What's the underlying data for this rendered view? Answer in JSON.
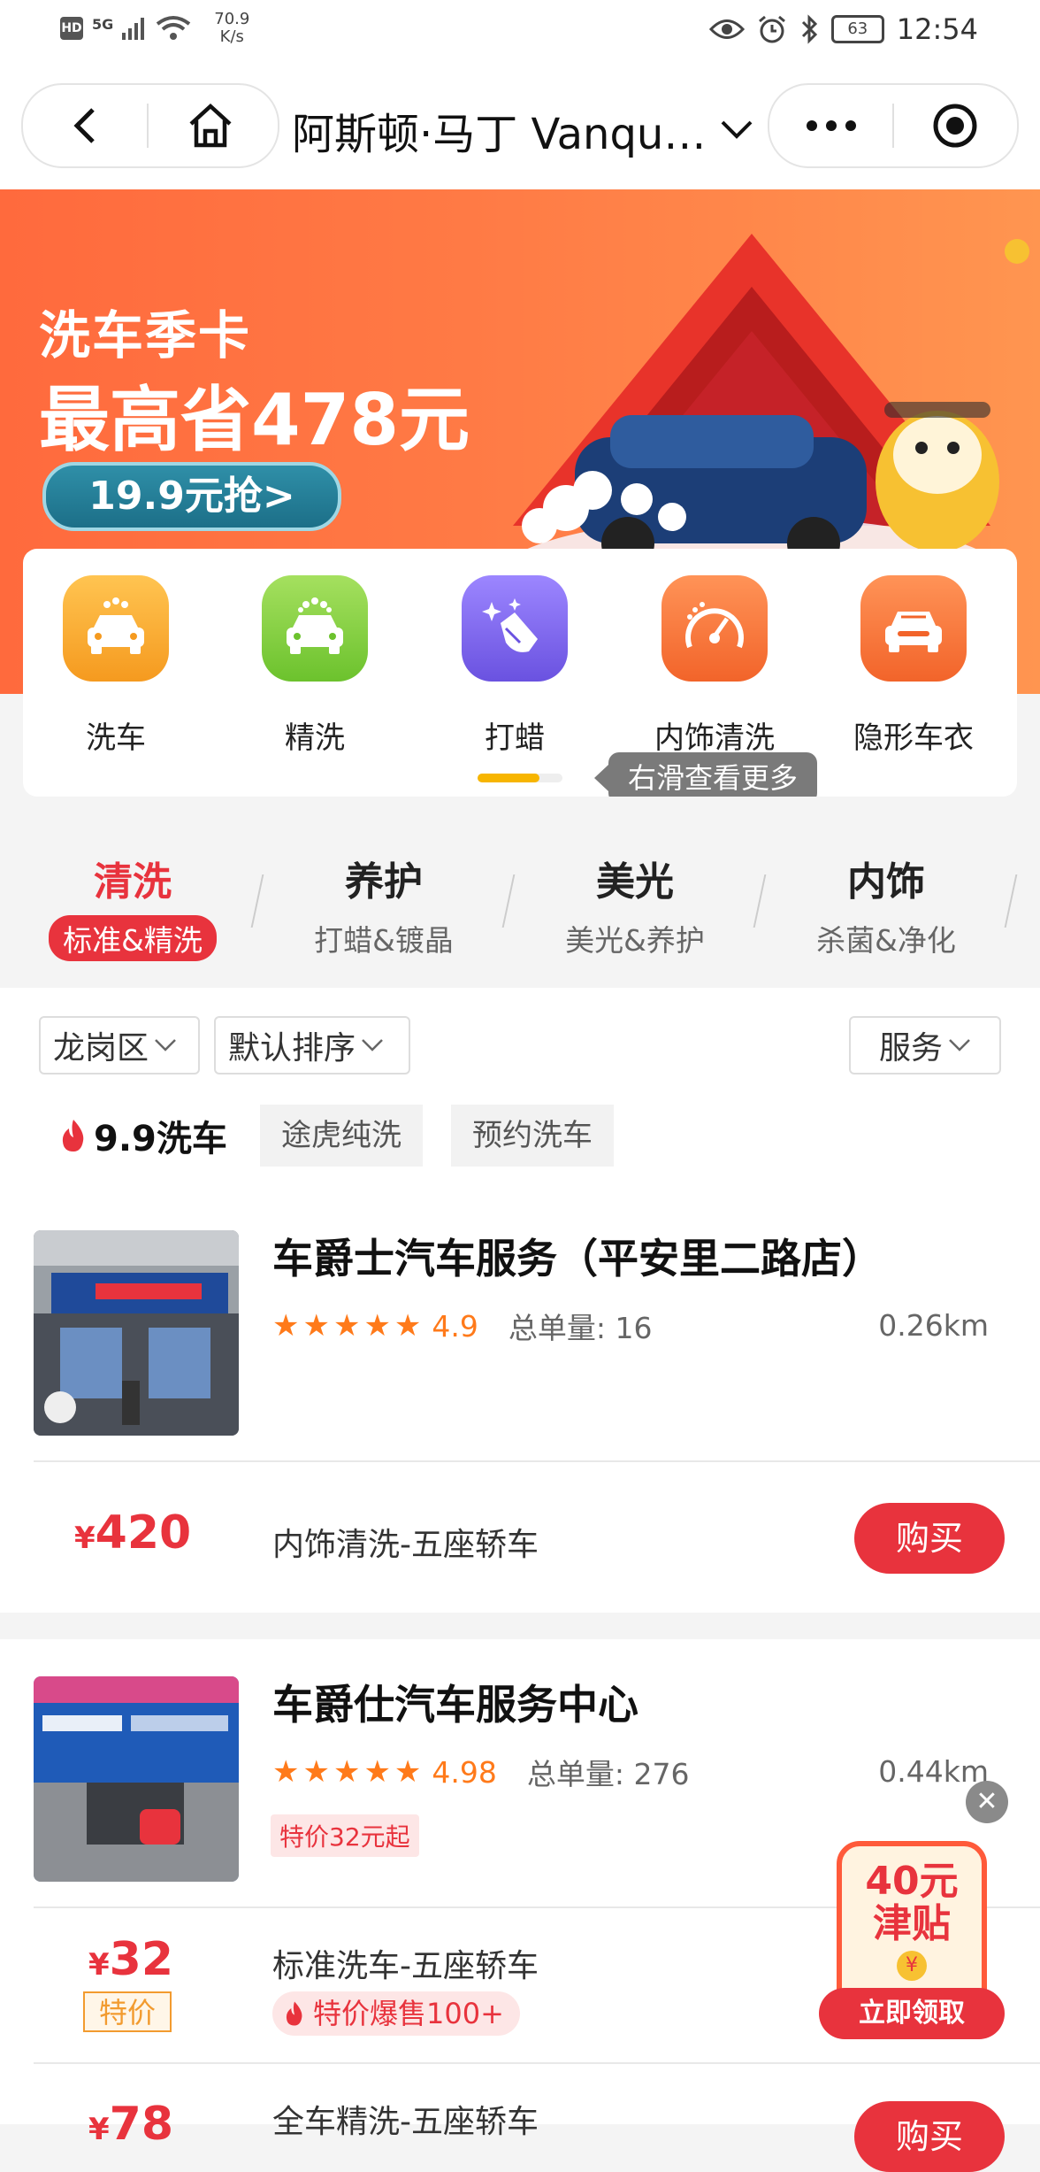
{
  "status_bar": {
    "badge": "HD",
    "network": "5G",
    "speed_value": "70.9",
    "speed_unit": "K/s",
    "battery": "63",
    "time": "12:54"
  },
  "nav": {
    "title": "阿斯顿·马丁 Vanqu…"
  },
  "banner": {
    "line1": "洗车季卡",
    "line2": "最高省478元",
    "cta": "19.9元抢>"
  },
  "categories": [
    {
      "label": "洗车",
      "icon": "car-wash-icon",
      "color": "#f7a928"
    },
    {
      "label": "精洗",
      "icon": "fine-wash-icon",
      "color": "#7ccc3a"
    },
    {
      "label": "打蜡",
      "icon": "wax-icon",
      "color": "#7a64e8"
    },
    {
      "label": "内饰清洗",
      "icon": "interior-clean-icon",
      "color": "#f2733a"
    },
    {
      "label": "隐形车衣",
      "icon": "invisible-film-icon",
      "color": "#f2733a"
    }
  ],
  "scroll_hint": "右滑查看更多",
  "tabs": [
    {
      "title": "清洗",
      "sub": "标准&精洗",
      "active": true
    },
    {
      "title": "养护",
      "sub": "打蜡&镀晶",
      "active": false
    },
    {
      "title": "美光",
      "sub": "美光&养护",
      "active": false
    },
    {
      "title": "内饰",
      "sub": "杀菌&净化",
      "active": false
    }
  ],
  "filters": {
    "district": "龙岗区",
    "sort": "默认排序",
    "service": "服务"
  },
  "promo": {
    "label": "9.9洗车",
    "chips": [
      "途虎纯洗",
      "预约洗车"
    ]
  },
  "shops": [
    {
      "name": "车爵士汽车服务（平安里二路店）",
      "stars": "★★★★★",
      "rating": "4.9",
      "orders": "总单量: 16",
      "distance": "0.26km",
      "services": [
        {
          "currency": "¥",
          "price": "420",
          "name": "内饰清洗-五座轿车",
          "buy": "购买"
        }
      ]
    },
    {
      "name": "车爵仕汽车服务中心",
      "stars": "★★★★★",
      "rating": "4.98",
      "orders": "总单量: 276",
      "distance": "0.44km",
      "tag": "特价32元起",
      "services": [
        {
          "currency": "¥",
          "price": "32",
          "badge": "特价",
          "name": "标准洗车-五座轿车",
          "hot": "特价爆售100+"
        },
        {
          "currency": "¥",
          "price": "78",
          "name": "全车精洗-五座轿车",
          "buy": "购买"
        }
      ]
    }
  ],
  "coupon": {
    "amount": "40元",
    "label": "津贴",
    "action": "立即领取"
  },
  "colors": {
    "accent": "#e8333d",
    "star": "#ff7a1a",
    "banner": "#ff6a3d"
  }
}
